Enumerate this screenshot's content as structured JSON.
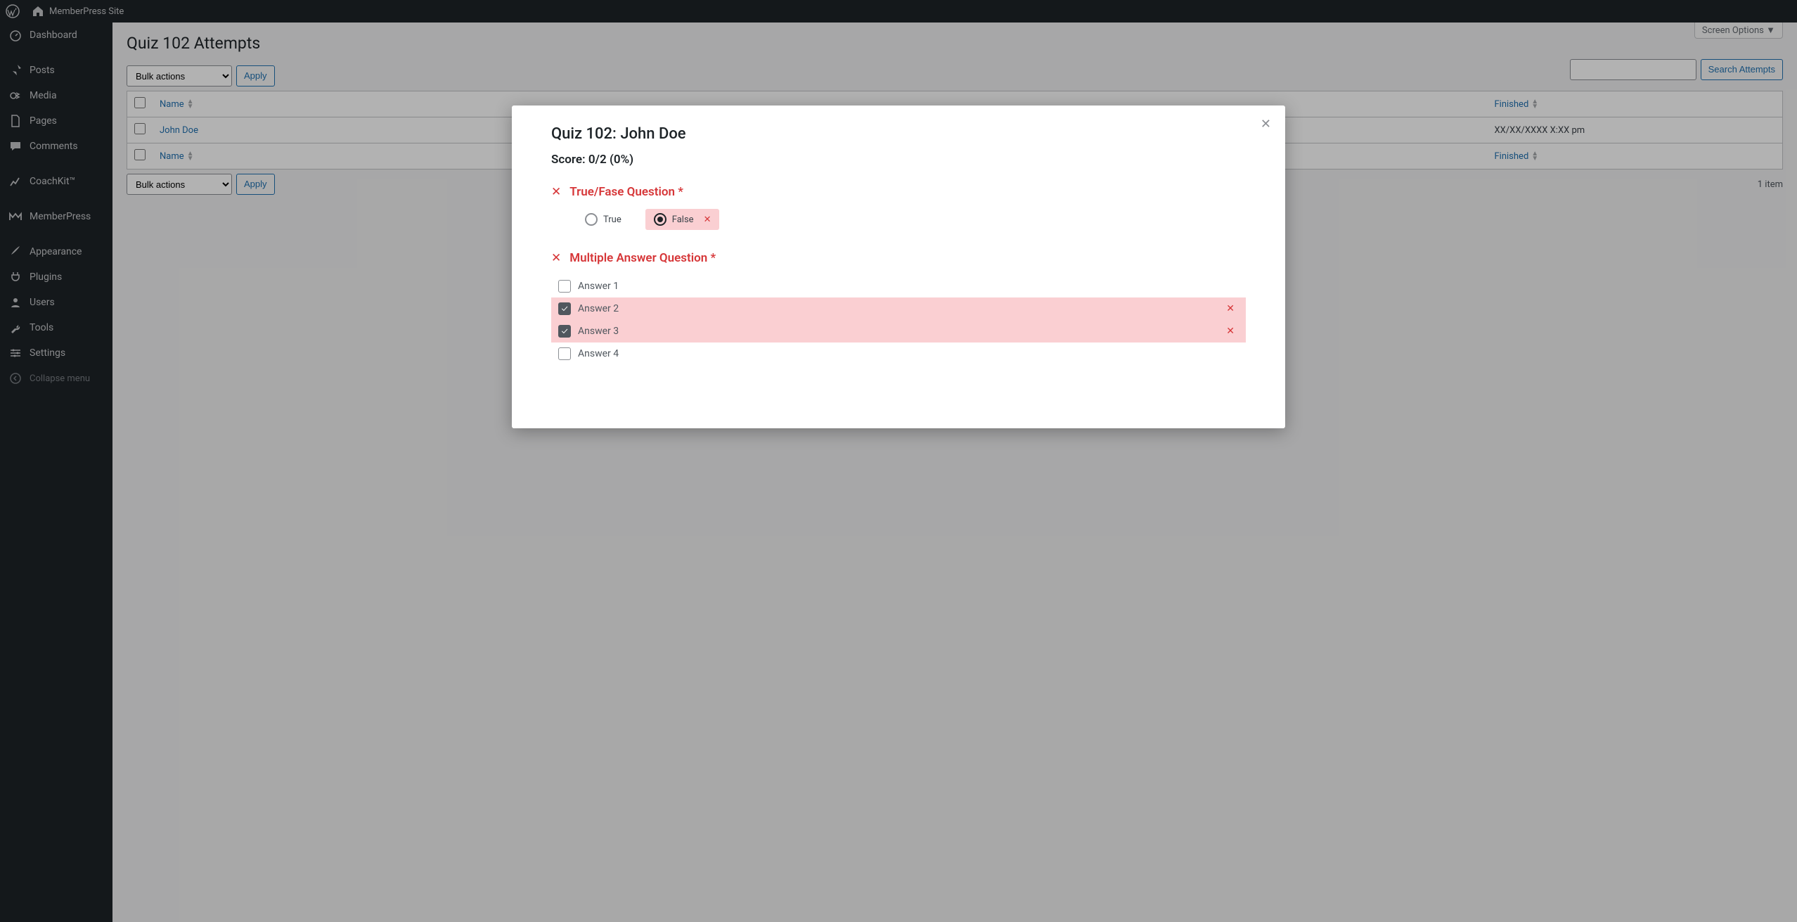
{
  "adminbar": {
    "site_name": "MemberPress Site"
  },
  "sidebar": {
    "items": [
      {
        "label": "Dashboard",
        "icon": "gauge"
      },
      {
        "label": "Posts",
        "icon": "pin"
      },
      {
        "label": "Media",
        "icon": "media"
      },
      {
        "label": "Pages",
        "icon": "page"
      },
      {
        "label": "Comments",
        "icon": "comment"
      },
      {
        "label": "CoachKit™",
        "icon": "chart"
      },
      {
        "label": "MemberPress",
        "icon": "mp"
      },
      {
        "label": "Appearance",
        "icon": "brush"
      },
      {
        "label": "Plugins",
        "icon": "plug"
      },
      {
        "label": "Users",
        "icon": "user"
      },
      {
        "label": "Tools",
        "icon": "wrench"
      },
      {
        "label": "Settings",
        "icon": "sliders"
      }
    ],
    "collapse_label": "Collapse menu"
  },
  "page": {
    "screen_options": "Screen Options",
    "title": "Quiz 102 Attempts",
    "bulk_actions_label": "Bulk actions",
    "apply_label": "Apply",
    "search_button": "Search Attempts",
    "item_count": "1 item",
    "columns": {
      "name": "Name",
      "finished": "Finished"
    },
    "rows": [
      {
        "name": "John Doe",
        "finished": "XX/XX/XXXX X:XX pm"
      }
    ]
  },
  "modal": {
    "title": "Quiz 102: John Doe",
    "score": "Score: 0/2 (0%)",
    "questions": [
      {
        "title": "True/Fase Question *",
        "type": "radio",
        "options": [
          {
            "label": "True",
            "selected": false,
            "wrong": false
          },
          {
            "label": "False",
            "selected": true,
            "wrong": true
          }
        ]
      },
      {
        "title": "Multiple Answer Question *",
        "type": "check",
        "options": [
          {
            "label": "Answer 1",
            "selected": false,
            "wrong": false
          },
          {
            "label": "Answer 2",
            "selected": true,
            "wrong": true
          },
          {
            "label": "Answer 3",
            "selected": true,
            "wrong": true
          },
          {
            "label": "Answer 4",
            "selected": false,
            "wrong": false
          }
        ]
      }
    ]
  }
}
